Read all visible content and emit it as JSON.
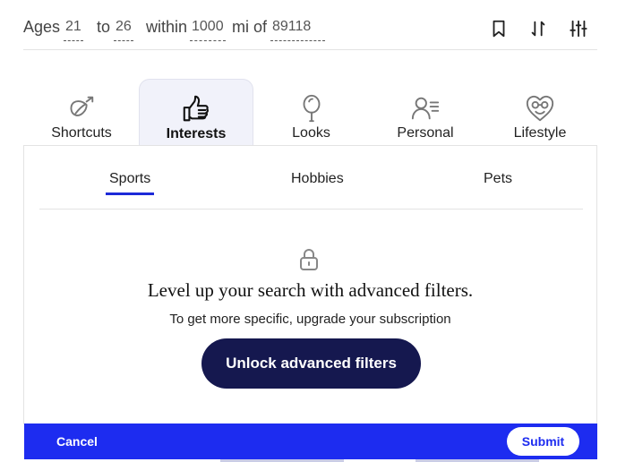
{
  "search": {
    "ages_label": "Ages",
    "age_min": "21",
    "to_label": "to",
    "age_max": "26",
    "within_label": "within",
    "distance": "1000",
    "mi_of_label": "mi of",
    "zip": "89118"
  },
  "toolbar": {
    "icons": [
      "bookmark-icon",
      "sort-icon",
      "filter-sliders-icon"
    ]
  },
  "tabs": [
    {
      "label": "Shortcuts",
      "icon": "shortcuts-icon",
      "active": false
    },
    {
      "label": "Interests",
      "icon": "thumbs-up-icon",
      "active": true
    },
    {
      "label": "Looks",
      "icon": "looks-icon",
      "active": false
    },
    {
      "label": "Personal",
      "icon": "personal-icon",
      "active": false
    },
    {
      "label": "Lifestyle",
      "icon": "lifestyle-icon",
      "active": false
    }
  ],
  "subtabs": [
    {
      "label": "Sports",
      "active": true
    },
    {
      "label": "Hobbies",
      "active": false
    },
    {
      "label": "Pets",
      "active": false
    }
  ],
  "upsell": {
    "icon": "lock-icon",
    "title": "Level up your search with advanced filters.",
    "subtitle": "To get more specific, upgrade your subscription",
    "button": "Unlock advanced filters"
  },
  "footer": {
    "cancel": "Cancel",
    "submit": "Submit"
  },
  "colors": {
    "accent_blue": "#1d2cf0",
    "navy_button": "#15184f",
    "active_tab_bg": "#f1f2fa"
  }
}
